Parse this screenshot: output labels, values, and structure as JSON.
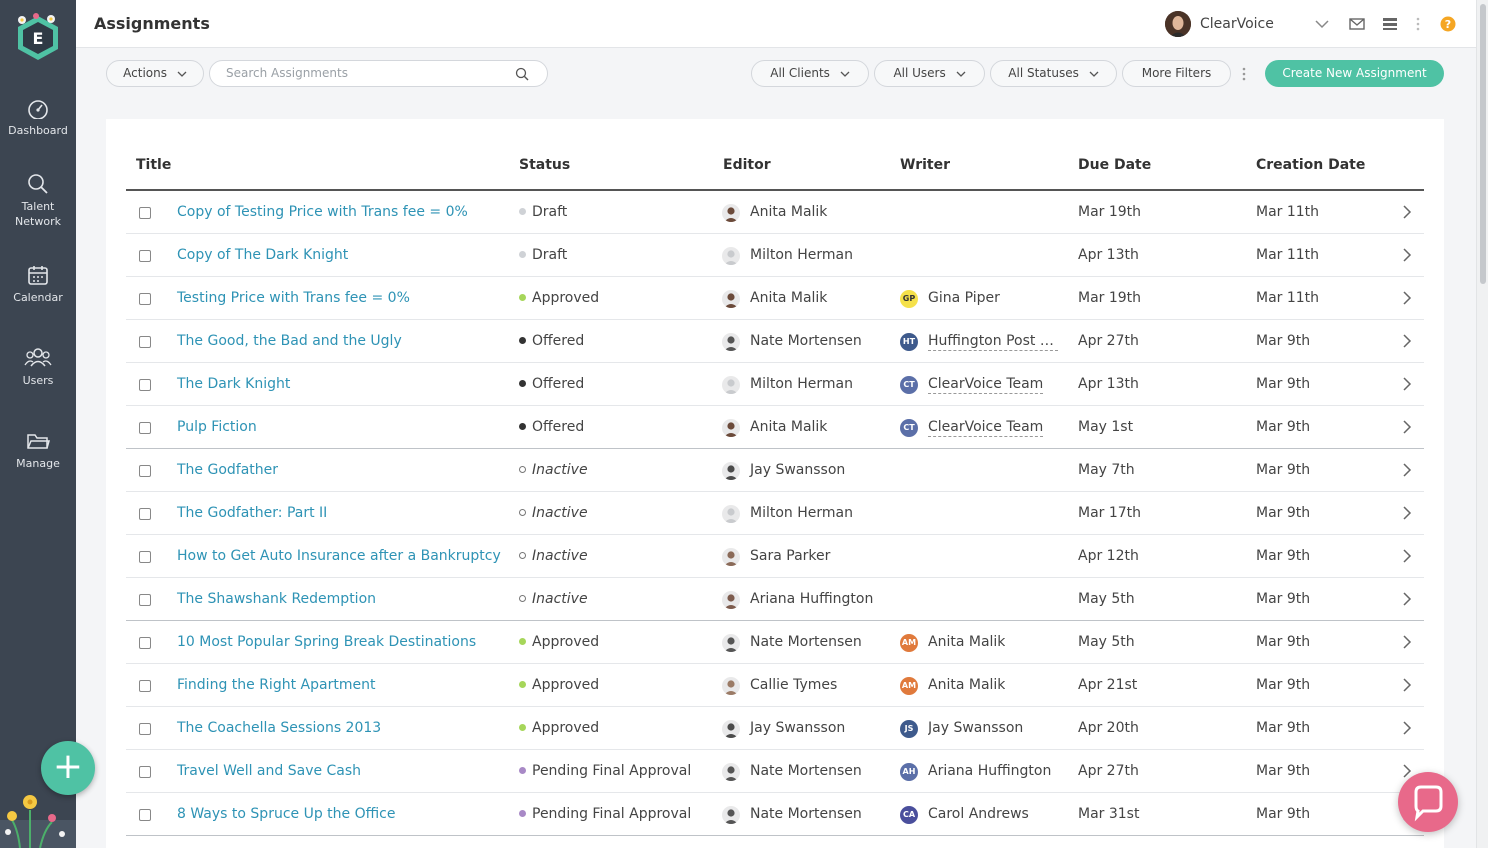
{
  "header": {
    "title": "Assignments",
    "account_name": "ClearVoice"
  },
  "sidebar": {
    "items": [
      {
        "label": "Dashboard"
      },
      {
        "label_line1": "Talent",
        "label_line2": "Network"
      },
      {
        "label": "Calendar"
      },
      {
        "label": "Users"
      },
      {
        "label": "Manage"
      }
    ],
    "fab_label": "+"
  },
  "toolbar": {
    "actions_label": "Actions",
    "search_placeholder": "Search Assignments",
    "clients_label": "All Clients",
    "users_label": "All Users",
    "statuses_label": "All Statuses",
    "more_filters_label": "More Filters",
    "create_label": "Create New Assignment"
  },
  "table": {
    "columns": [
      "Title",
      "Status",
      "Editor",
      "Writer",
      "Due Date",
      "Creation Date"
    ],
    "rows": [
      {
        "title": "Copy of Testing Price with Trans fee = 0%",
        "status": "Draft",
        "editor": "Anita Malik",
        "writer": "",
        "writer_initials": "",
        "due": "Mar 19th",
        "created": "Mar 11th"
      },
      {
        "title": "Copy of The Dark Knight",
        "status": "Draft",
        "editor": "Milton Herman",
        "writer": "",
        "writer_initials": "",
        "due": "Apr 13th",
        "created": "Mar 11th"
      },
      {
        "title": "Testing Price with Trans fee = 0%",
        "status": "Approved",
        "editor": "Anita Malik",
        "writer": "Gina Piper",
        "writer_initials": "GP",
        "due": "Mar 19th",
        "created": "Mar 11th"
      },
      {
        "title": "The Good, the Bad and the Ugly",
        "status": "Offered",
        "editor": "Nate Mortensen",
        "writer": "Huffington Post T...",
        "writer_initials": "HT",
        "due": "Apr 27th",
        "created": "Mar 9th"
      },
      {
        "title": "The Dark Knight",
        "status": "Offered",
        "editor": "Milton Herman",
        "writer": "ClearVoice Team",
        "writer_initials": "CT",
        "due": "Apr 13th",
        "created": "Mar 9th"
      },
      {
        "title": "Pulp Fiction",
        "status": "Offered",
        "editor": "Anita Malik",
        "writer": "ClearVoice Team",
        "writer_initials": "CT",
        "due": "May 1st",
        "created": "Mar 9th"
      },
      {
        "title": "The Godfather",
        "status": "Inactive",
        "editor": "Jay Swansson",
        "writer": "",
        "writer_initials": "",
        "due": "May 7th",
        "created": "Mar 9th"
      },
      {
        "title": "The Godfather: Part II",
        "status": "Inactive",
        "editor": "Milton Herman",
        "writer": "",
        "writer_initials": "",
        "due": "Mar 17th",
        "created": "Mar 9th"
      },
      {
        "title": "How to Get Auto Insurance after a Bankruptcy",
        "status": "Inactive",
        "editor": "Sara Parker",
        "writer": "",
        "writer_initials": "",
        "due": "Apr 12th",
        "created": "Mar 9th"
      },
      {
        "title": "The Shawshank Redemption",
        "status": "Inactive",
        "editor": "Ariana Huffington",
        "writer": "",
        "writer_initials": "",
        "due": "May 5th",
        "created": "Mar 9th"
      },
      {
        "title": "10 Most Popular Spring Break Destinations",
        "status": "Approved",
        "editor": "Nate Mortensen",
        "writer": "Anita Malik",
        "writer_initials": "AM",
        "due": "May 5th",
        "created": "Mar 9th"
      },
      {
        "title": "Finding the Right Apartment",
        "status": "Approved",
        "editor": "Callie Tymes",
        "writer": "Anita Malik",
        "writer_initials": "AM",
        "due": "Apr 21st",
        "created": "Mar 9th"
      },
      {
        "title": "The Coachella Sessions 2013",
        "status": "Approved",
        "editor": "Jay Swansson",
        "writer": "Jay Swansson",
        "writer_initials": "JS",
        "due": "Apr 20th",
        "created": "Mar 9th"
      },
      {
        "title": "Travel Well and Save Cash",
        "status": "Pending Final Approval",
        "editor": "Nate Mortensen",
        "writer": "Ariana Huffington",
        "writer_initials": "AH",
        "due": "Apr 27th",
        "created": "Mar 9th"
      },
      {
        "title": "8 Ways to Spruce Up the Office",
        "status": "Pending Final Approval",
        "editor": "Nate Mortensen",
        "writer": "Carol Andrews",
        "writer_initials": "CA",
        "due": "Mar 31st",
        "created": "Mar 9th"
      }
    ]
  },
  "colors": {
    "accent": "#4fc2a4",
    "link": "#2e93b5",
    "sidebar": "#3c4551",
    "status_draft": "#cfd2d6",
    "status_approved": "#a6d65a",
    "status_offered": "#333333",
    "status_pending": "#a889c6",
    "help": "#f5a623"
  }
}
